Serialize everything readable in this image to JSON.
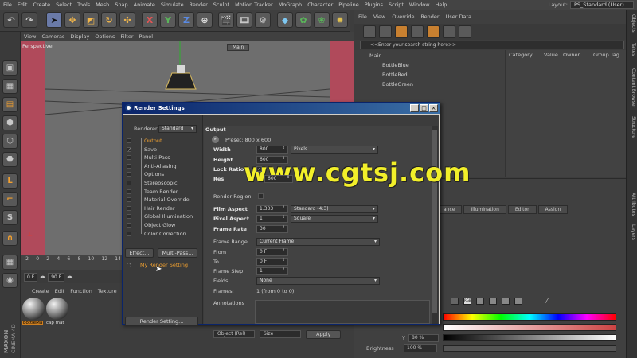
{
  "menubar": {
    "items": [
      "File",
      "Edit",
      "Create",
      "Select",
      "Tools",
      "Mesh",
      "Snap",
      "Animate",
      "Simulate",
      "Render",
      "Sculpt",
      "Motion Tracker",
      "MoGraph",
      "Character",
      "Pipeline",
      "Plugins",
      "Script",
      "Window",
      "Help"
    ],
    "layout_label": "Layout:",
    "layout_value": "PS_Standard (User)"
  },
  "toolbar": {
    "axis_x": "X",
    "axis_y": "Y",
    "axis_z": "Z"
  },
  "viewport": {
    "menu": [
      "View",
      "Cameras",
      "Display",
      "Options",
      "Filter",
      "Panel"
    ],
    "label": "Perspective",
    "camera_tag": "Main"
  },
  "timeline": {
    "ticks": [
      "-2",
      "0",
      "2",
      "4",
      "6",
      "8",
      "10",
      "12",
      "14"
    ],
    "current_frame": "0 F",
    "end_frame": "90 F"
  },
  "materials": {
    "menu": [
      "Create",
      "Edit",
      "Function",
      "Texture"
    ],
    "items": [
      {
        "name": "bottleMa"
      },
      {
        "name": "cap mat"
      }
    ]
  },
  "branding": {
    "maxon": "MAXON",
    "c4d": "CINEMA 4D"
  },
  "object_manager": {
    "menu": [
      "File",
      "View",
      "Override",
      "Render",
      "User Data"
    ],
    "search_placeholder": "<<Enter your search string here>>",
    "root": "Main",
    "children": [
      "BottleBlue",
      "BottleRed",
      "BottleGreen"
    ],
    "columns": [
      "Category",
      "Value",
      "Owner",
      "Group Tag"
    ]
  },
  "right_tabs": [
    "Objects",
    "Takes",
    "Content Browser",
    "Structure",
    "Attributes",
    "Layers"
  ],
  "attributes": {
    "tabs": [
      "ance",
      "Illumination",
      "Editor",
      "Assign"
    ],
    "v_value": "80 %",
    "brightness_label": "Brightness",
    "brightness_value": "100 %",
    "coord_mode": "Object (Rel)",
    "coord_size": "Size",
    "apply_label": "Apply",
    "y_label": "Y",
    "rgb_label": "RGB"
  },
  "render_settings": {
    "title": "Render Settings",
    "renderer_label": "Renderer",
    "renderer_value": "Standard",
    "nav": [
      {
        "label": "Output",
        "active": true,
        "checked": false
      },
      {
        "label": "Save",
        "active": false,
        "checked": true
      },
      {
        "label": "Multi-Pass",
        "active": false,
        "checked": false
      },
      {
        "label": "Anti-Aliasing",
        "active": false,
        "checked": false
      },
      {
        "label": "Options",
        "active": false,
        "checked": false
      },
      {
        "label": "Stereoscopic",
        "active": false,
        "checked": false
      },
      {
        "label": "Team Render",
        "active": false,
        "checked": false
      },
      {
        "label": "Material Override",
        "active": false,
        "checked": false
      },
      {
        "label": "Hair Render",
        "active": false,
        "checked": false
      },
      {
        "label": "Global Illumination",
        "active": false,
        "checked": false
      },
      {
        "label": "Object Glow",
        "active": false,
        "checked": false
      },
      {
        "label": "Color Correction",
        "active": false,
        "checked": false
      }
    ],
    "effect_button": "Effect...",
    "multipass_button": "Multi-Pass...",
    "preset_item": "My Render Setting",
    "render_setting_button": "Render Setting...",
    "section_title": "Output",
    "preset_label": "Preset: 800 x 600",
    "fields": {
      "width_label": "Width",
      "width_value": "800",
      "width_unit": "Pixels",
      "height_label": "Height",
      "height_value": "600",
      "lock_ratio_label": "Lock Ratio",
      "res_partial_1": "Res",
      "res_partial_2": "600",
      "render_region_label": "Render Region",
      "film_aspect_label": "Film Aspect",
      "film_aspect_value": "1.333",
      "film_aspect_preset": "Standard (4:3)",
      "pixel_aspect_label": "Pixel Aspect",
      "pixel_aspect_value": "1",
      "pixel_aspect_preset": "Square",
      "frame_rate_label": "Frame Rate",
      "frame_rate_value": "30",
      "frame_range_label": "Frame Range",
      "frame_range_value": "Current Frame",
      "from_label": "From",
      "from_value": "0 F",
      "to_label": "To",
      "to_value": "0 F",
      "frame_step_label": "Frame Step",
      "frame_step_value": "1",
      "fields_label": "Fields",
      "fields_value": "None",
      "frames_label": "Frames:",
      "frames_value": "1 (from 0 to 0)",
      "annotations_label": "Annotations"
    }
  },
  "watermark": "www.cgtsj.com"
}
